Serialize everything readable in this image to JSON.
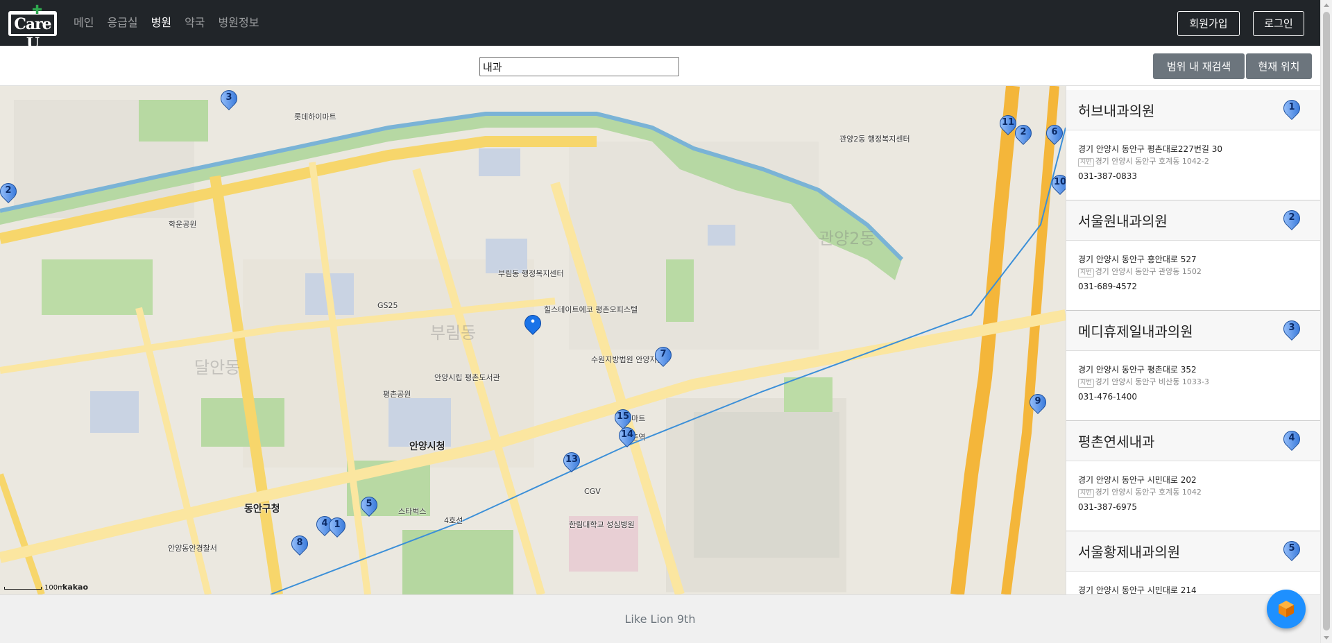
{
  "brand": {
    "logo_text": "Care U",
    "logo_icon": "green-cross-icon",
    "accent": "#2fa84f"
  },
  "nav": {
    "links": [
      {
        "label": "메인",
        "active": false
      },
      {
        "label": "응급실",
        "active": false
      },
      {
        "label": "병원",
        "active": true
      },
      {
        "label": "약국",
        "active": false
      },
      {
        "label": "병원정보",
        "active": false
      }
    ],
    "signup_label": "회원가입",
    "login_label": "로그인"
  },
  "search": {
    "value": "내과",
    "research_label": "범위 내 재검색",
    "current_location_label": "현재 위치"
  },
  "map": {
    "scale_label": "100m",
    "provider_label": "kakao",
    "labels": {
      "anyang_city_hall": "안양시청",
      "dongan_gu_office": "동안구청",
      "pyeongchon_park": "평촌공원",
      "bureum_dong": "부림동",
      "gwanyang2_dong": "관양2동",
      "dalan_dong": "달안동",
      "hagun_park": "학운공원",
      "anyang_police": "안양동안경찰서",
      "hallym_hospital": "한림대학교 성심병원",
      "metro_line": "4호선",
      "pyeongchon_station": "평촌역",
      "herb_label": "수원지방법원 안양지원",
      "library": "안양시립 평촌도서관",
      "lotte_hi": "롯데하이마트",
      "gs25": "GS25",
      "starbucks": "스타벅스",
      "cgv": "CGV",
      "emart": "이마트",
      "hill_state": "힐스테이트에코 평촌오피스텔",
      "bureum_center": "부림동 행정복지센터",
      "gwanyang_center": "관양2동 행정복지센터"
    },
    "markers": [
      "3",
      "2",
      "11",
      "2",
      "6",
      "10",
      "7",
      "9",
      "15",
      "14",
      "13",
      "5",
      "4",
      "1",
      "8"
    ]
  },
  "results": [
    {
      "num": "1",
      "name": "허브내과의원",
      "road_addr": "경기 안양시 동안구 평촌대로227번길 30",
      "jibun_tag": "지번",
      "jibun_addr": "경기 안양시 동안구 호계동 1042-2",
      "phone": "031-387-0833"
    },
    {
      "num": "2",
      "name": "서울원내과의원",
      "road_addr": "경기 안양시 동안구 흥안대로 527",
      "jibun_tag": "지번",
      "jibun_addr": "경기 안양시 동안구 관양동 1502",
      "phone": "031-689-4572"
    },
    {
      "num": "3",
      "name": "메디휴제일내과의원",
      "road_addr": "경기 안양시 동안구 평촌대로 352",
      "jibun_tag": "지번",
      "jibun_addr": "경기 안양시 동안구 비산동 1033-3",
      "phone": "031-476-1400"
    },
    {
      "num": "4",
      "name": "평촌연세내과",
      "road_addr": "경기 안양시 동안구 시민대로 202",
      "jibun_tag": "지번",
      "jibun_addr": "경기 안양시 동안구 호계동 1042",
      "phone": "031-387-6975"
    },
    {
      "num": "5",
      "name": "서울황제내과의원",
      "road_addr": "경기 안양시 동안구 시민대로 214",
      "jibun_tag": "",
      "jibun_addr": "",
      "phone": ""
    }
  ],
  "footer": {
    "text": "Like Lion 9th"
  },
  "chat": {
    "icon": "cube-icon",
    "color": "#1e90ff"
  }
}
